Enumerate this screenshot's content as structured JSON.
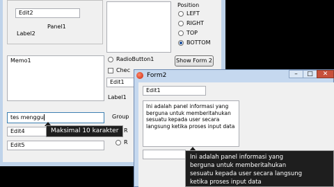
{
  "form1": {
    "edit2": "Edit2",
    "panel1": "Panel1",
    "label2": "Label2",
    "memo1": "Memo1",
    "position_title": "Position",
    "position_options": [
      {
        "label": "LEFT",
        "checked": false
      },
      {
        "label": "RIGHT",
        "checked": false
      },
      {
        "label": "TOP",
        "checked": false
      },
      {
        "label": "BOTTOM",
        "checked": true
      }
    ],
    "radiobutton1": "RadioButton1",
    "checkbox_label": "Chec",
    "edit1": "Edit1",
    "label1": "Label1",
    "show_form2": "Show Form 2",
    "edit3": "tes menggu",
    "group_label": "Group",
    "edit4": "Edit4",
    "edit5": "Edit5",
    "r1": "R",
    "r2": "R",
    "tooltip": "Maksimal 10 karakter"
  },
  "form2": {
    "title": "Form2",
    "edit1": "Edit1",
    "memo_text": "Ini adalah panel informasi yang berguna untuk memberitahukan sesuatu kepada user secara langsung ketika proses input data",
    "tooltip_line1": "Ini adalah panel informasi yang",
    "tooltip_line2": "berguna untuk memberitahukan",
    "tooltip_line3": "sesuatu kepada user secara langsung",
    "tooltip_line4": "ketika proses input data"
  }
}
